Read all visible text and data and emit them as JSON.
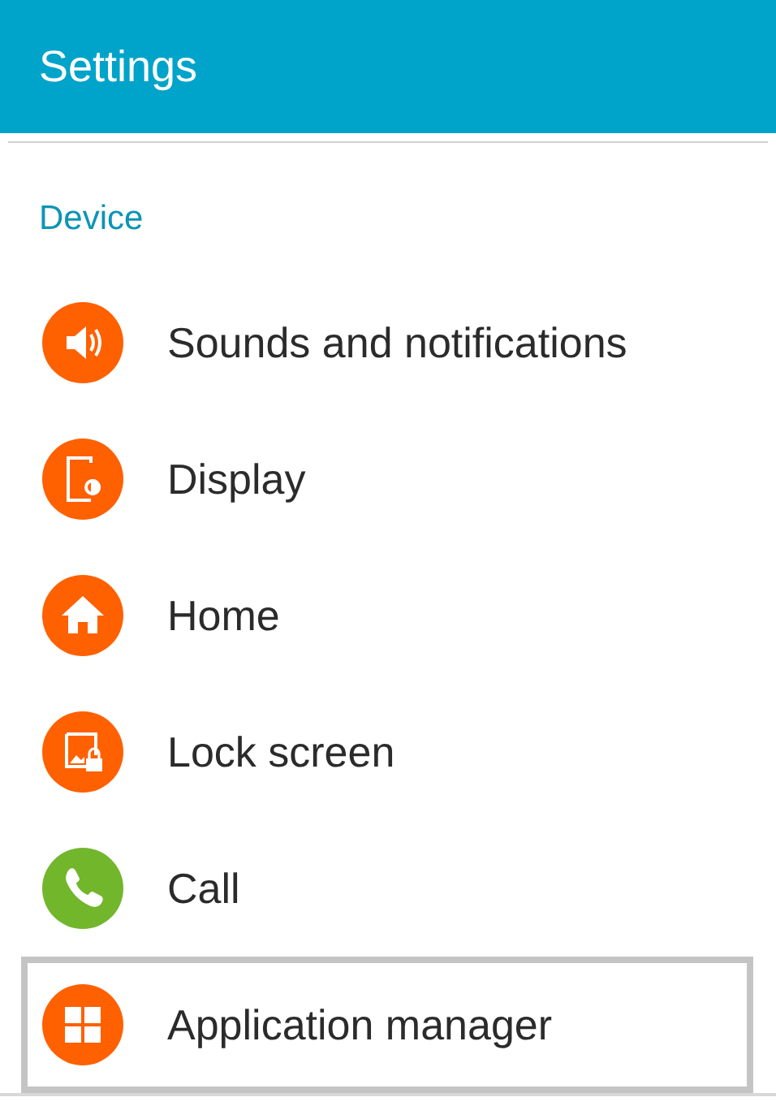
{
  "header": {
    "title": "Settings"
  },
  "section": {
    "title": "Device"
  },
  "items": [
    {
      "label": "Sounds and notifications",
      "kind": "speaker",
      "color": "#ff6000",
      "selected": false
    },
    {
      "label": "Display",
      "kind": "display",
      "color": "#ff6000",
      "selected": false
    },
    {
      "label": "Home",
      "kind": "home",
      "color": "#ff6000",
      "selected": false
    },
    {
      "label": "Lock screen",
      "kind": "lock",
      "color": "#ff6000",
      "selected": false
    },
    {
      "label": "Call",
      "kind": "phone",
      "color": "#72b62c",
      "selected": false
    },
    {
      "label": "Application manager",
      "kind": "apps",
      "color": "#ff6000",
      "selected": true
    }
  ]
}
